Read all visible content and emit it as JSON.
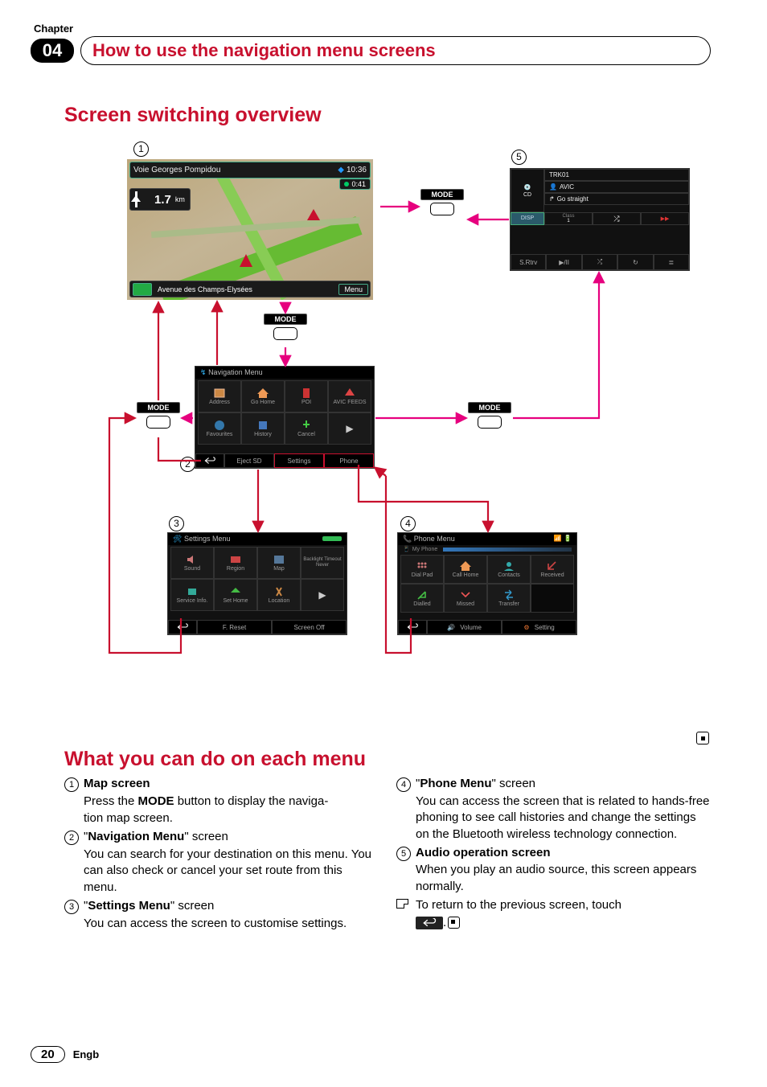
{
  "chapter_label": "Chapter",
  "chapter_num": "04",
  "chapter_title": "How to use the navigation menu screens",
  "section1_title": "Screen switching overview",
  "section2_title": "What you can do on each menu",
  "mode_label": "MODE",
  "map": {
    "top_street": "Voie Georges Pompidou",
    "time": "10:36",
    "eta": "0:41",
    "distance": "1.7",
    "distance_unit": "km",
    "bottom_street": "Avenue des Champs-Elysées",
    "menu_btn": "Menu"
  },
  "nav_menu": {
    "title": "Navigation Menu",
    "items": [
      "Address",
      "Go Home",
      "POI",
      "AVIC FEEDS",
      "Favourites",
      "History",
      "Cancel",
      ""
    ],
    "bottom": [
      "",
      "Eject SD",
      "Settings",
      "Phone"
    ]
  },
  "settings_menu": {
    "title": "Settings Menu",
    "items": [
      "Sound",
      "Region",
      "Map",
      "Backlight Timeout Never",
      "Service Info.",
      "Set Home",
      "Location",
      ""
    ],
    "bottom": [
      "",
      "F. Reset",
      "Screen Off"
    ]
  },
  "phone_menu": {
    "title": "Phone Menu",
    "subtitle": "My Phone",
    "items": [
      "Dial Pad",
      "Call Home",
      "Contacts",
      "Received",
      "Dialled",
      "Missed",
      "Transfer",
      ""
    ],
    "bottom": [
      "",
      "Volume",
      "Setting"
    ]
  },
  "audio": {
    "track": "TRK01",
    "artist": "AVIC",
    "guide": "Go straight",
    "cd": "CD",
    "disp": "DISP",
    "trk_num": "1",
    "btns": [
      "S.Rtrv",
      "▶/II",
      "⤮",
      "↻",
      "≣"
    ]
  },
  "list": {
    "i1_title": "Map screen",
    "i1_body_a": "Press the ",
    "i1_body_b": " button to display the naviga-",
    "i1_body_c": "tion map screen.",
    "i2_pre": "\"",
    "i2_title": "Navigation Menu",
    "i2_post": "\" screen",
    "i2_body": "You can search for your destination on this menu. You can also check or cancel your set route from this menu.",
    "i3_title": "Settings Menu",
    "i3_post": "\" screen",
    "i3_body": "You can access the screen to customise settings.",
    "i4_title": "Phone Menu",
    "i4_post": "\" screen",
    "i4_body": "You can access the screen that is related to hands-free phoning to see call histories and change the settings on the Bluetooth wireless technology connection.",
    "i5_title": "Audio operation screen",
    "i5_body": "When you play an audio source, this screen appears normally.",
    "note": "To return to the previous screen, touch",
    "period": "."
  },
  "page_num": "20",
  "lang": "Engb"
}
